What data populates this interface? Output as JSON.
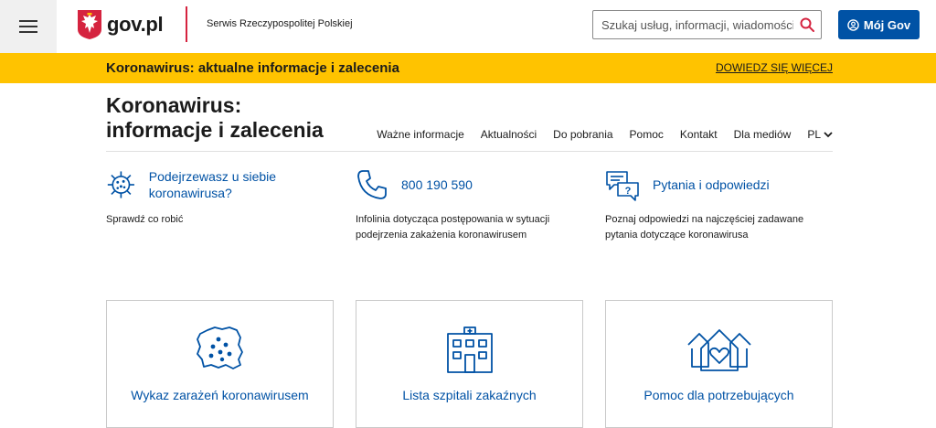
{
  "header": {
    "logo_text": "gov.pl",
    "service_name": "Serwis Rzeczypospolitej Polskiej",
    "search_placeholder": "Szukaj usług, informacji, wiadomości",
    "account_button": "Mój Gov"
  },
  "banner": {
    "title": "Koronawirus: aktualne informacje i zalecenia",
    "link": "DOWIEDZ SIĘ WIĘCEJ"
  },
  "page": {
    "title": "Koronawirus: informacje i zalecenia"
  },
  "nav": {
    "items": [
      "Ważne informacje",
      "Aktualności",
      "Do pobrania",
      "Pomoc",
      "Kontakt",
      "Dla mediów"
    ],
    "language": "PL"
  },
  "info": [
    {
      "title": "Podejrzewasz u siebie koronawirusa?",
      "desc": "Sprawdź co robić",
      "icon": "virus-icon"
    },
    {
      "title": "800 190 590",
      "desc": "Infolinia dotycząca postępowania w sytuacji podejrzenia zakażenia koronawirusem",
      "icon": "phone-icon"
    },
    {
      "title": "Pytania i odpowiedzi",
      "desc": "Poznaj odpowiedzi na najczęściej zadawane pytania dotyczące koronawirusa",
      "icon": "faq-icon"
    }
  ],
  "cards": [
    {
      "label": "Wykaz zarażeń koronawirusem",
      "icon": "poland-map-icon"
    },
    {
      "label": "Lista szpitali zakaźnych",
      "icon": "hospital-icon"
    },
    {
      "label": "Pomoc dla potrzebujących",
      "icon": "houses-heart-icon"
    }
  ],
  "colors": {
    "accent": "#0052a5",
    "banner": "#ffc300",
    "brand_red": "#d5233f"
  }
}
